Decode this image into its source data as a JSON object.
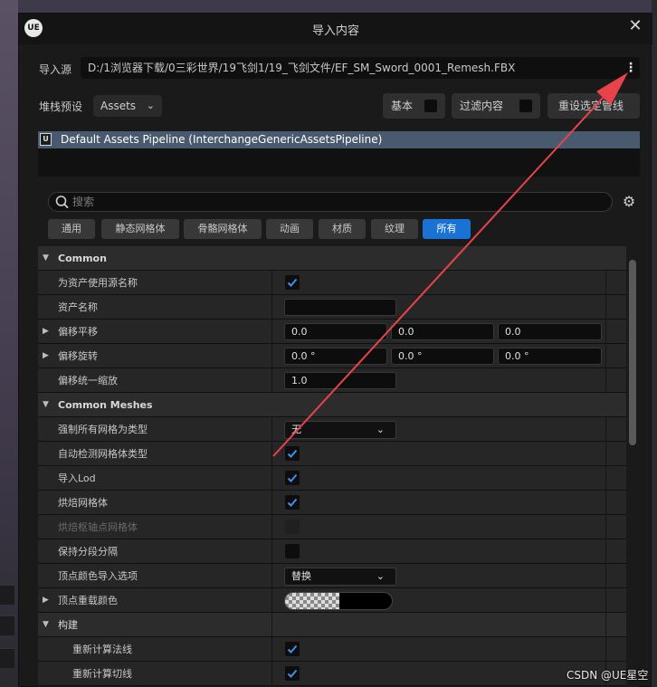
{
  "dialog": {
    "title": "导入内容",
    "logo": "UE",
    "close_icon": "✕"
  },
  "source": {
    "label": "导入源",
    "path": "D:/1浏览器下载/0三彩世界/19飞剑1/19_飞剑文件/EF_SM_Sword_0001_Remesh.FBX",
    "menu_icon": "⋮"
  },
  "stack": {
    "label": "堆栈预设",
    "value": "Assets",
    "chevron": "⌄"
  },
  "toolbar": {
    "basic_label": "基本",
    "filter_label": "过滤内容",
    "reset_label": "重设选定管线"
  },
  "pipeline": {
    "icon": "U",
    "label": "Default Assets Pipeline (InterchangeGenericAssetsPipeline)"
  },
  "search": {
    "placeholder": "搜索"
  },
  "tabs": [
    {
      "label": "通用"
    },
    {
      "label": "静态网格体"
    },
    {
      "label": "骨骼网格体"
    },
    {
      "label": "动画"
    },
    {
      "label": "材质"
    },
    {
      "label": "纹理"
    },
    {
      "label": "所有"
    }
  ],
  "properties": {
    "common": {
      "header": "Common",
      "use_source_name": {
        "label": "为资产使用源名称",
        "checked": true
      },
      "asset_name": {
        "label": "资产名称",
        "value": ""
      },
      "offset_translation": {
        "label": "偏移平移",
        "x": "0.0",
        "y": "0.0",
        "z": "0.0"
      },
      "offset_rotation": {
        "label": "偏移旋转",
        "x": "0.0 °",
        "y": "0.0 °",
        "z": "0.0 °"
      },
      "offset_uniform_scale": {
        "label": "偏移统一缩放",
        "value": "1.0"
      }
    },
    "common_meshes": {
      "header": "Common Meshes",
      "force_all_mesh_as_type": {
        "label": "强制所有网格为类型",
        "value": "无"
      },
      "auto_detect_mesh_type": {
        "label": "自动检测网格体类型",
        "checked": true
      },
      "import_lods": {
        "label": "导入Lod",
        "checked": true
      },
      "bake_meshes": {
        "label": "烘焙网格体",
        "checked": true
      },
      "bake_pivot_meshes": {
        "label": "烘焙枢轴点网格体",
        "checked": false
      },
      "keep_sections_separate": {
        "label": "保持分段分隔",
        "checked": false
      },
      "vertex_color_import_option": {
        "label": "顶点颜色导入选项",
        "value": "替换"
      },
      "vertex_override_color": {
        "label": "顶点重载颜色"
      }
    },
    "build": {
      "header": "构建",
      "recompute_normals": {
        "label": "重新计算法线",
        "checked": true
      },
      "recompute_tangents": {
        "label": "重新计算切线",
        "checked": true
      }
    }
  },
  "chevrons": {
    "expanded": "▼",
    "collapsed": "▶",
    "dropdown": "⌄"
  },
  "watermark": "CSDN @UE星空",
  "colors": {
    "accent": "#1a73d4",
    "selection": "#4a5a6e",
    "annotation_arrow": "#e8434a"
  }
}
